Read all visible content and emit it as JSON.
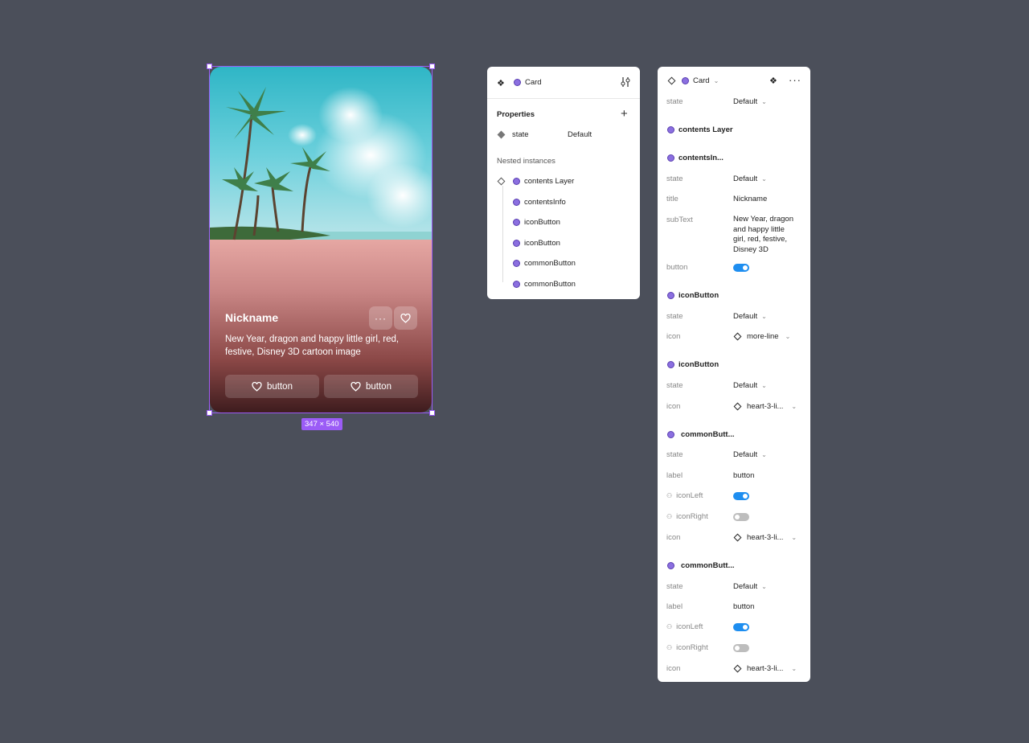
{
  "card": {
    "title": "Nickname",
    "subtext": "New Year, dragon and happy little girl, red, festive, Disney 3D cartoon image",
    "button_left_label": "button",
    "button_right_label": "button",
    "size_badge": "347 × 540"
  },
  "props_panel": {
    "header_title": "Card",
    "properties_heading": "Properties",
    "state_label": "state",
    "state_value": "Default",
    "nested_heading": "Nested instances",
    "nested": [
      "contents Layer",
      "contentsInfo",
      "iconButton",
      "iconButton",
      "commonButton",
      "commonButton"
    ]
  },
  "detail_panel": {
    "header_title": "Card",
    "top_state_label": "state",
    "top_state_value": "Default",
    "contents_layer": "contents Layer",
    "contents_info": {
      "name": "contentsIn...",
      "state_label": "state",
      "state_value": "Default",
      "title_label": "title",
      "title_value": "Nickname",
      "subtext_label": "subText",
      "subtext_value": "New Year, dragon and happy little girl, red, festive, Disney 3D",
      "button_label": "button",
      "button_on": true
    },
    "icon_button_1": {
      "name": "iconButton",
      "state_label": "state",
      "state_value": "Default",
      "icon_label": "icon",
      "icon_value": "more-line"
    },
    "icon_button_2": {
      "name": "iconButton",
      "state_label": "state",
      "state_value": "Default",
      "icon_label": "icon",
      "icon_value": "heart-3-li..."
    },
    "common_button_1": {
      "name": "commonButt...",
      "state_label": "state",
      "state_value": "Default",
      "label_label": "label",
      "label_value": "button",
      "icon_left_label": "iconLeft",
      "icon_left_on": true,
      "icon_right_label": "iconRight",
      "icon_right_on": false,
      "icon_label": "icon",
      "icon_value": "heart-3-li..."
    },
    "common_button_2": {
      "name": "commonButt...",
      "state_label": "state",
      "state_value": "Default",
      "label_label": "label",
      "label_value": "button",
      "icon_left_label": "iconLeft",
      "icon_left_on": true,
      "icon_right_label": "iconRight",
      "icon_right_on": false,
      "icon_label": "icon",
      "icon_value": "heart-3-li..."
    }
  },
  "colors": {
    "canvas": "#4b4f5a",
    "selection": "#9b5cf6",
    "toggle_on": "#1e8ef0",
    "instance_dot": "#8b6fe0"
  }
}
